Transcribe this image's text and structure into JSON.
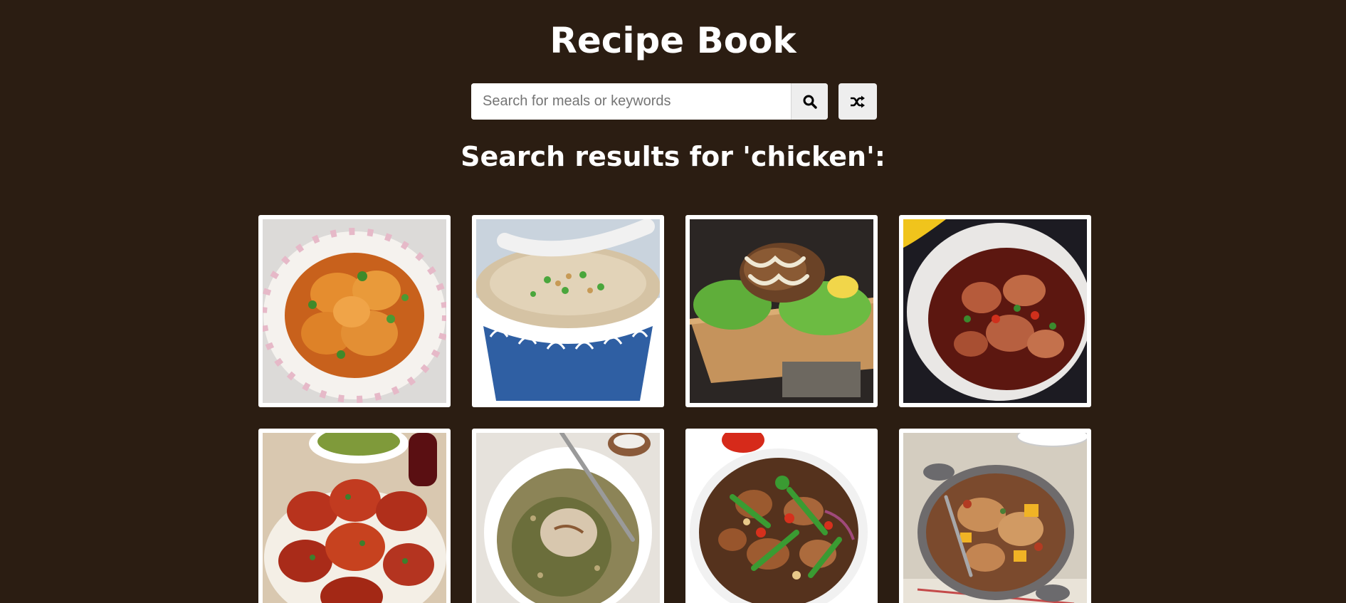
{
  "header": {
    "title": "Recipe Book"
  },
  "search": {
    "placeholder": "Search for meals or keywords",
    "value": "",
    "search_icon": "search-icon",
    "random_icon": "shuffle-icon"
  },
  "results": {
    "heading": "Search results for 'chicken':",
    "meals": [
      {
        "icon": "chicken-curry-bowl-image",
        "colors": [
          "#d9822b",
          "#f3efe9"
        ]
      },
      {
        "icon": "rice-congee-bowl-image",
        "colors": [
          "#c9b79c",
          "#2c5a9a"
        ]
      },
      {
        "icon": "grilled-chicken-lettuce-image",
        "colors": [
          "#6b4a2e",
          "#c7a06b"
        ]
      },
      {
        "icon": "chicken-stew-pot-image",
        "colors": [
          "#7a2a1e",
          "#e8e6e4"
        ]
      },
      {
        "icon": "tandoori-chicken-image",
        "colors": [
          "#b3361f",
          "#e9d9c2"
        ]
      },
      {
        "icon": "chicken-lentils-bowl-image",
        "colors": [
          "#8c8a5a",
          "#f2f0ea"
        ]
      },
      {
        "icon": "chicken-stir-fry-image",
        "colors": [
          "#7b3a22",
          "#ffffff"
        ]
      },
      {
        "icon": "chicken-casserole-image",
        "colors": [
          "#a66b3a",
          "#d8d6cf"
        ]
      }
    ]
  },
  "colors": {
    "background": "#2b1d12",
    "button": "#eeeeee",
    "text": "#ffffff"
  }
}
